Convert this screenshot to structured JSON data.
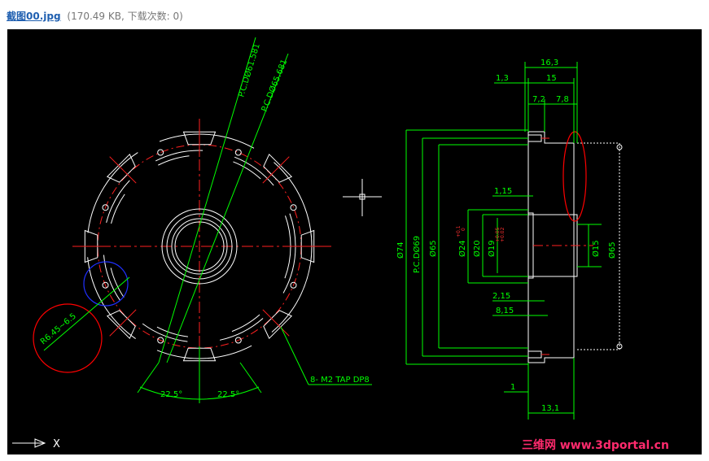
{
  "header": {
    "file_name": "截图00.jpg",
    "file_meta": "(170.49 KB, 下载次数: 0)"
  },
  "drawing": {
    "left_view": {
      "pcd_1": "P.C.DØ61.581",
      "pcd_2": "P.C.DØ65.681",
      "angle_1": "22.5°",
      "angle_2": "22.5°",
      "tap_note": "8- M2 TAP DP8",
      "radius_note": "R6.45~6.5"
    },
    "right_view": {
      "dim_16_3": "16,3",
      "dim_1_3": "1,3",
      "dim_15_top": "15",
      "dim_7_2": "7,2",
      "dim_7_8": "7,8",
      "dim_1_15": "1,15",
      "dim_2_15": "2,15",
      "dim_8_15": "8,15",
      "dim_1": "1",
      "dim_13_1": "13,1",
      "dia_74": "Ø74",
      "dia_pcd69": "P.C.DØ69",
      "dia_65": "Ø65",
      "dia_24": "Ø24",
      "dia_20": "Ø20",
      "dia_19": "Ø19",
      "dia_15": "Ø15",
      "dia_65_side": "Ø65",
      "tol_24_upper": "+0.1",
      "tol_24_lower": "0",
      "tol_19_upper": "+0.05",
      "tol_19_lower": "+0.02"
    },
    "axis_label": "X",
    "watermark": "三维网 www.3dportal.cn"
  },
  "colors": {
    "background": "#000000",
    "dimension": "#00ff00",
    "outline": "#ffffff",
    "centerline": "#ff2020",
    "highlight": "#ff0000",
    "circle_blue": "#2030ff"
  }
}
